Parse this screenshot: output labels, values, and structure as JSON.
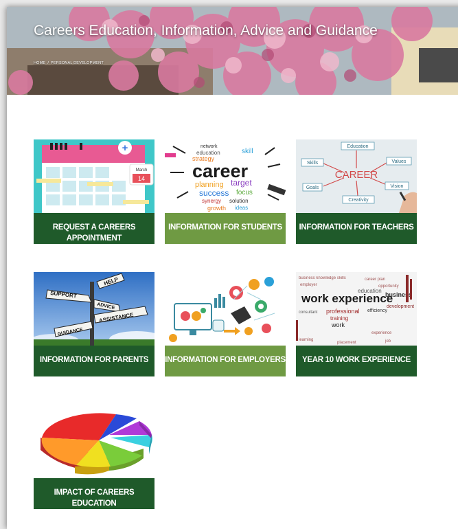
{
  "header": {
    "title": "Careers Education, Information, Advice and Guidance",
    "breadcrumb": [
      "HOME",
      "PERSONAL DEVELOPMENT"
    ],
    "breadcrumb_separator": "/"
  },
  "tiles": [
    {
      "label": "REQUEST A CAREERS APPOINTMENT",
      "bar_color": "#1f5a2a",
      "image": "calendar-icon",
      "image_text": {
        "month": "March",
        "day": "14"
      }
    },
    {
      "label": "INFORMATION FOR STUDENTS",
      "bar_color": "#6f9a43",
      "image": "career-word-cloud",
      "image_text": {
        "main": "career",
        "w1": "network",
        "w2": "education",
        "w3": "strategy",
        "w4": "skill",
        "w5": "planning",
        "w6": "target",
        "w7": "success",
        "w8": "focus",
        "w9": "synergy",
        "w10": "solution",
        "w11": "growth",
        "w12": "ideas"
      }
    },
    {
      "label": "INFORMATION FOR TEACHERS",
      "bar_color": "#1f5a2a",
      "image": "career-mind-map",
      "image_text": {
        "center": "CAREER",
        "n1": "Education",
        "n2": "Skills",
        "n3": "Values",
        "n4": "Goals",
        "n5": "Vision",
        "n6": "Creativity"
      }
    },
    {
      "label": "INFORMATION FOR PARENTS",
      "bar_color": "#1f5a2a",
      "image": "signpost",
      "image_text": {
        "s1": "HELP",
        "s2": "SUPPORT",
        "s3": "ADVICE",
        "s4": "ASSISTANCE",
        "s5": "GUIDANCE"
      }
    },
    {
      "label": "INFORMATION FOR EMPLOYERS",
      "bar_color": "#6f9a43",
      "image": "business-icons"
    },
    {
      "label": "YEAR 10 WORK EXPERIENCE",
      "bar_color": "#1f5a2a",
      "image": "work-experience-word-cloud",
      "image_text": {
        "main": "work experience",
        "w1": "education",
        "w2": "business",
        "w3": "professional",
        "w4": "training",
        "w5": "efficiency",
        "w6": "development",
        "w7": "work",
        "w8": "consultant"
      }
    },
    {
      "label": "IMPACT OF CAREERS EDUCATION",
      "bar_color": "#1f5a2a",
      "image": "pie-chart-3d"
    }
  ]
}
